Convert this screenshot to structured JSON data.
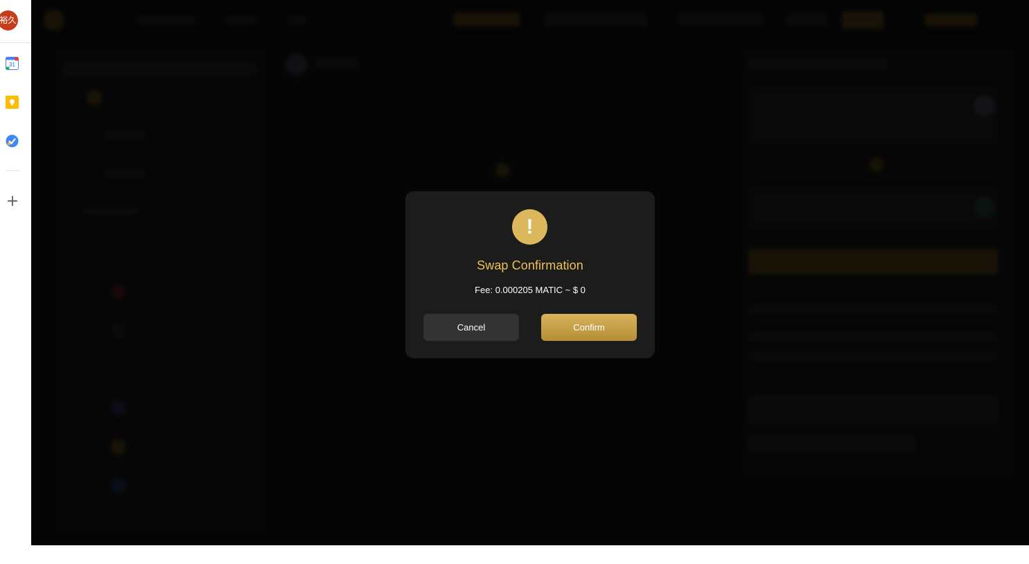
{
  "rail": {
    "avatar_text": "裕久",
    "apps": [
      {
        "name": "calendar-icon",
        "label": "31",
        "color": "#4285f4"
      },
      {
        "name": "keep-icon",
        "color": "#fbbc04"
      },
      {
        "name": "tasks-icon",
        "color": "#4285f4"
      }
    ],
    "add_label": "+"
  },
  "modal": {
    "icon_glyph": "!",
    "title": "Swap Confirmation",
    "fee_text": "Fee: 0.000205 MATIC ~ $ 0",
    "cancel_label": "Cancel",
    "confirm_label": "Confirm"
  },
  "colors": {
    "accent": "#efc24f",
    "confirm_button": "#c9a24a",
    "cancel_button": "#333333",
    "modal_bg": "#1c1c1c",
    "app_bg": "#0c0c0c"
  }
}
